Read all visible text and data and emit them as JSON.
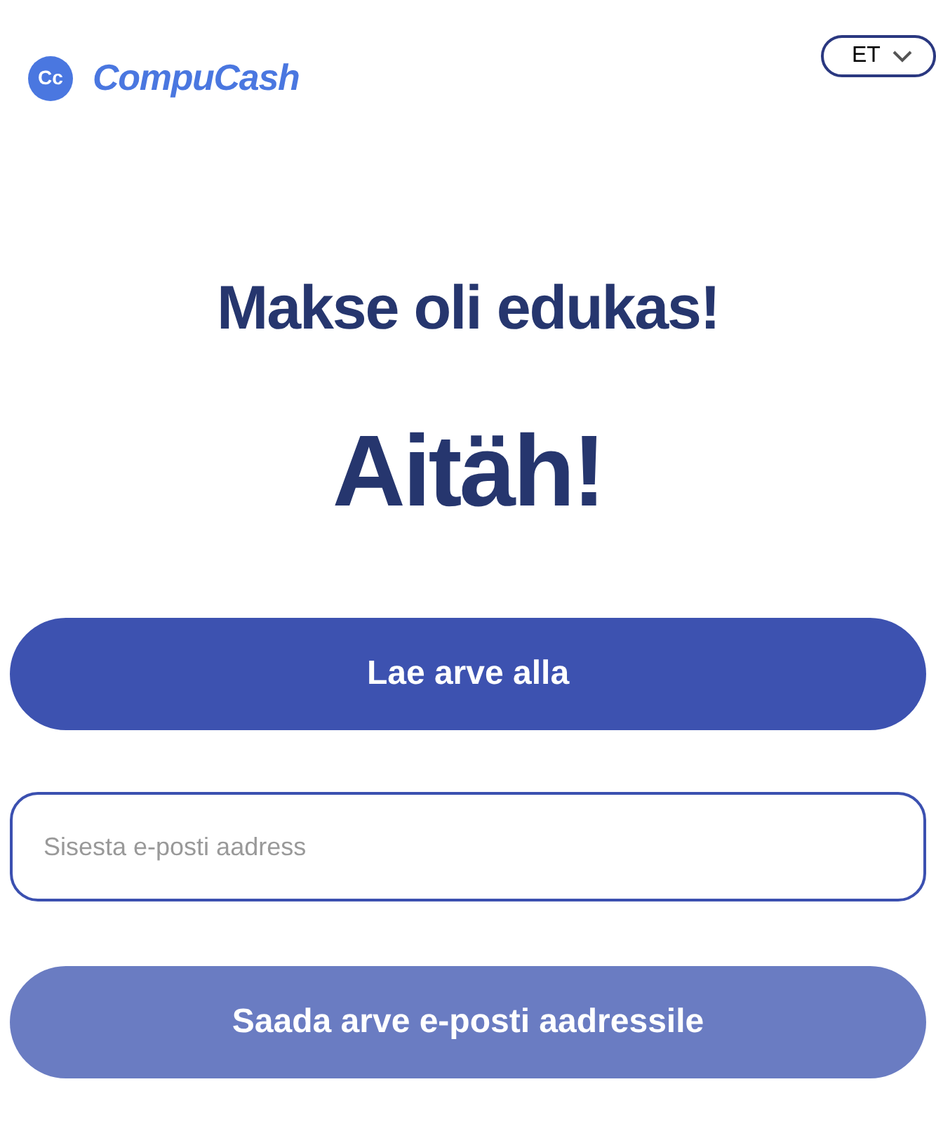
{
  "logo": {
    "mark": "Cc",
    "name": "CompuCash"
  },
  "language": {
    "label": "ET"
  },
  "heading": "Makse oli edukas!",
  "thanks": "Aitäh!",
  "download_button": {
    "label": "Lae arve alla",
    "disabled": false
  },
  "email_field": {
    "placeholder": "Sisesta e-posti aadress"
  },
  "send_button": {
    "label": "Saada arve e-posti aadressile",
    "disabled": true
  }
}
